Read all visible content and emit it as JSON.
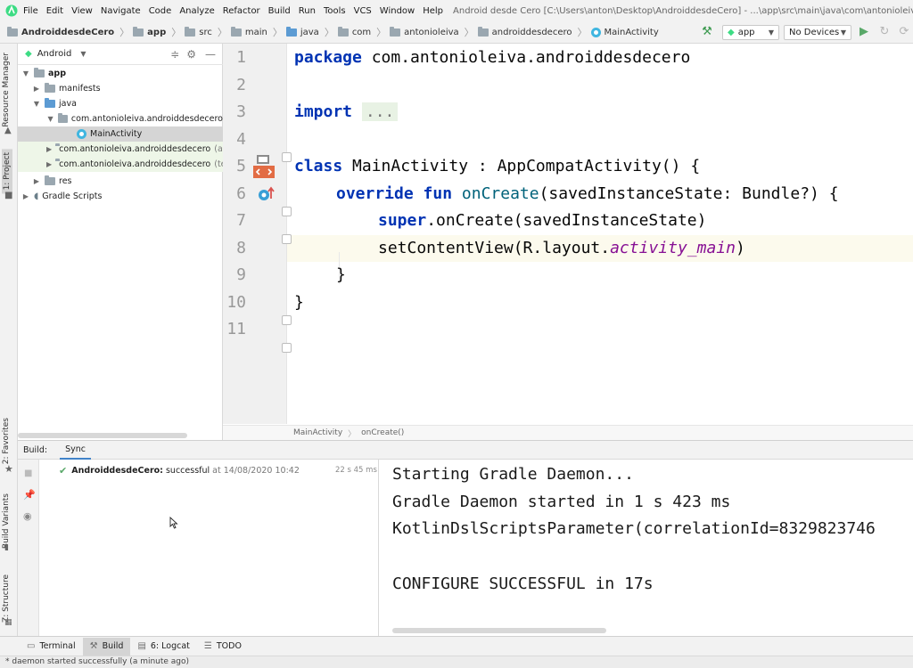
{
  "menubar": {
    "items": [
      "File",
      "Edit",
      "View",
      "Navigate",
      "Code",
      "Analyze",
      "Refactor",
      "Build",
      "Run",
      "Tools",
      "VCS",
      "Window",
      "Help"
    ],
    "window_title": "Android desde Cero [C:\\Users\\anton\\Desktop\\AndroiddesdeCero] - ...\\app\\src\\main\\java\\com\\antonioleiva\\androiddesdecero\\Main"
  },
  "navbar": {
    "crumbs": [
      "AndroiddesdeCero",
      "app",
      "src",
      "main",
      "java",
      "com",
      "antonioleiva",
      "androiddesdecero",
      "MainActivity"
    ],
    "run_config": "app",
    "device": "No Devices"
  },
  "left_stripe": {
    "resource_manager": "Resource Manager",
    "project": "1: Project",
    "favorites": "2: Favorites",
    "build_variants": "Build Variants",
    "structure": "Z: Structure"
  },
  "project": {
    "view_mode": "Android",
    "tree": [
      {
        "label": "app",
        "bold": true
      },
      {
        "label": "manifests"
      },
      {
        "label": "java"
      },
      {
        "label": "com.antonioleiva.androiddesdecero"
      },
      {
        "label": "MainActivity"
      },
      {
        "label": "com.antonioleiva.androiddesdecero",
        "suffix": "(ar"
      },
      {
        "label": "com.antonioleiva.androiddesdecero",
        "suffix": "(te"
      },
      {
        "label": "res"
      },
      {
        "label": "Gradle Scripts"
      }
    ]
  },
  "editor": {
    "line_numbers": [
      "1",
      "2",
      "3",
      "4",
      "5",
      "6",
      "7",
      "8",
      "9",
      "10",
      "11"
    ],
    "code": {
      "l1_kw": "package",
      "l1_rest": " com.antonioleiva.androiddesdecero",
      "l3_kw": "import",
      "l3_fold": "...",
      "l6_kw": "class",
      "l6_rest": " MainActivity : AppCompatActivity() {",
      "l7_kw": "override fun",
      "l7_fn": "onCreate",
      "l7_rest": "(savedInstanceState: Bundle?) {",
      "l8_kw": "super",
      "l8_rest": ".onCreate(savedInstanceState)",
      "l9_pre": "setContentView(R.layout.",
      "l9_it": "activity_main",
      "l9_post": ")",
      "l10": "}",
      "l11": "}"
    },
    "breadcrumb": [
      "MainActivity",
      "onCreate()"
    ]
  },
  "build": {
    "tab_build": "Build:",
    "tab_sync": "Sync",
    "result_project": "AndroiddesdeCero:",
    "result_status": "successful",
    "result_time": "at 14/08/2020 10:42",
    "duration": "22 s 45 ms",
    "console": [
      "Starting Gradle Daemon...",
      "Gradle Daemon started in 1 s 423 ms",
      "KotlinDslScriptsParameter(correlationId=8329823746",
      "",
      "CONFIGURE SUCCESSFUL in 17s"
    ]
  },
  "bottom_tools": {
    "terminal": "Terminal",
    "build": "Build",
    "logcat": "6: Logcat",
    "todo": "TODO"
  },
  "status": {
    "message": "* daemon started successfully (a minute ago)"
  },
  "colors": {
    "keyword": "#0033b3",
    "function": "#00627a",
    "italic_field": "#871094",
    "success": "#59a869",
    "current_line": "#fcfaed"
  }
}
